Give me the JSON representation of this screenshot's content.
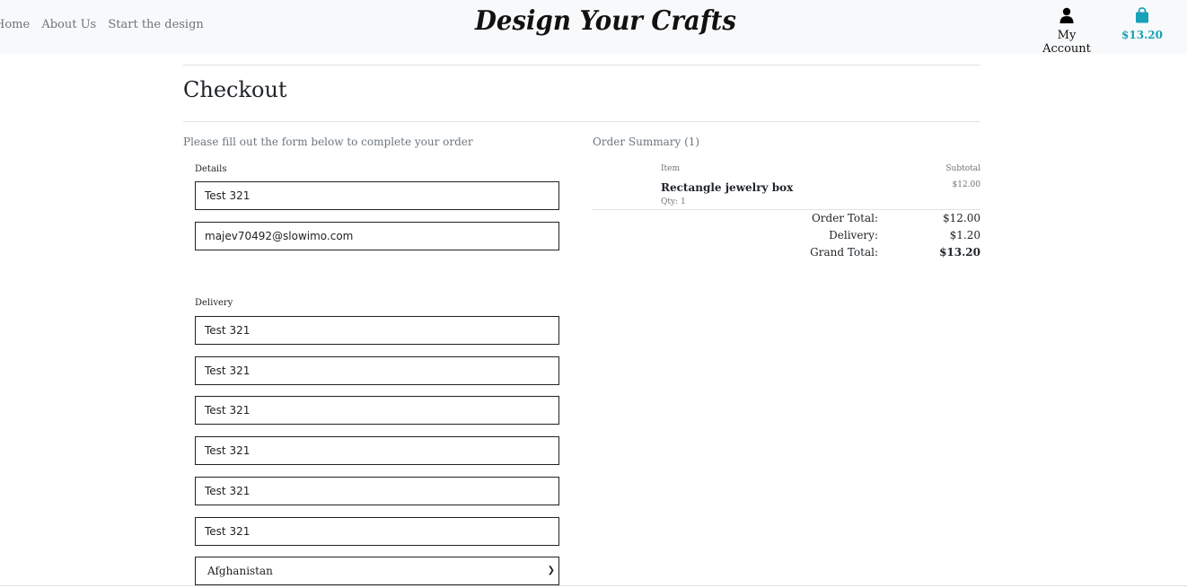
{
  "nav": {
    "links": [
      "Home",
      "About Us",
      "Start the design"
    ],
    "logo": "Design Your Crafts",
    "account_label": "My Account",
    "bag_total": "$13.20",
    "bag_color": "#17a2b8"
  },
  "page": {
    "title": "Checkout",
    "form_hint": "Please fill out the form below to complete your order"
  },
  "details": {
    "legend": "Details",
    "full_name": "Test 321",
    "email": "majev70492@slowimo.com"
  },
  "delivery": {
    "legend": "Delivery",
    "fields": [
      "Test 321",
      "Test 321",
      "Test 321",
      "Test 321",
      "Test 321",
      "Test 321"
    ],
    "country": "Afghanistan"
  },
  "summary": {
    "title": "Order Summary (1)",
    "col_item": "Item",
    "col_subtotal": "Subtotal",
    "item": {
      "name": "Rectangle jewelry box",
      "qty": "Qty: 1",
      "subtotal": "$12.00"
    },
    "order_total_label": "Order Total:",
    "order_total": "$12.00",
    "delivery_label": "Delivery:",
    "delivery": "$1.20",
    "grand_total_label": "Grand Total:",
    "grand_total": "$13.20"
  }
}
